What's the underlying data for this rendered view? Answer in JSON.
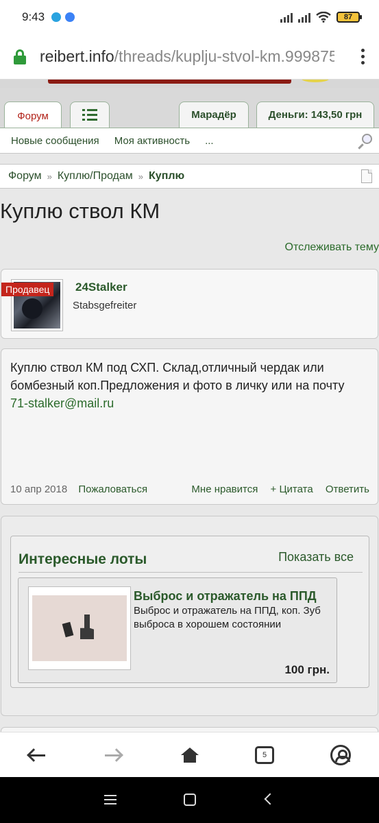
{
  "status_bar": {
    "time": "9:43",
    "battery": "87"
  },
  "browser": {
    "url_host": "reibert.info",
    "url_path": "/threads/kuplju-stvol-km.999875"
  },
  "nav": {
    "tabs": {
      "forum": "Форум",
      "marauder": "Марадёр",
      "money": "Деньги: 143,50 грн"
    },
    "subnav": {
      "new_messages": "Новые сообщения",
      "my_activity": "Моя активность",
      "more": "..."
    }
  },
  "breadcrumb": {
    "items": [
      "Форум",
      "Куплю/Продам"
    ],
    "current": "Куплю",
    "separator": "»"
  },
  "thread": {
    "title": "Куплю ствол КМ",
    "follow": "Отслеживать тему"
  },
  "author": {
    "badge": "Продавец",
    "name": "24Stalker",
    "rank": "Stabsgefreiter"
  },
  "post": {
    "text": "Куплю ствол КМ под СХП. Склад,отличный чердак или бомбезный коп.Предложения и фото в личку или на почту",
    "email": "71-stalker@mail.ru",
    "date": "10 апр 2018",
    "report": "Пожаловаться",
    "like": "Мне нравится",
    "quote": "+ Цитата",
    "reply": "Ответить"
  },
  "lots": {
    "title": "Интересные лоты",
    "show_all": "Показать все",
    "items": [
      {
        "title": "Выброс и отражатель на ППД",
        "description": "Выброс и отражатель на ППД, коп. Зуб выброса в хорошем состоянии",
        "price": "100 грн."
      }
    ]
  },
  "browser_nav": {
    "tabs_count": "5"
  },
  "colors": {
    "accent_green": "#2b5a2b",
    "accent_red": "#c4251c",
    "lock_green": "#2f9a3a"
  }
}
